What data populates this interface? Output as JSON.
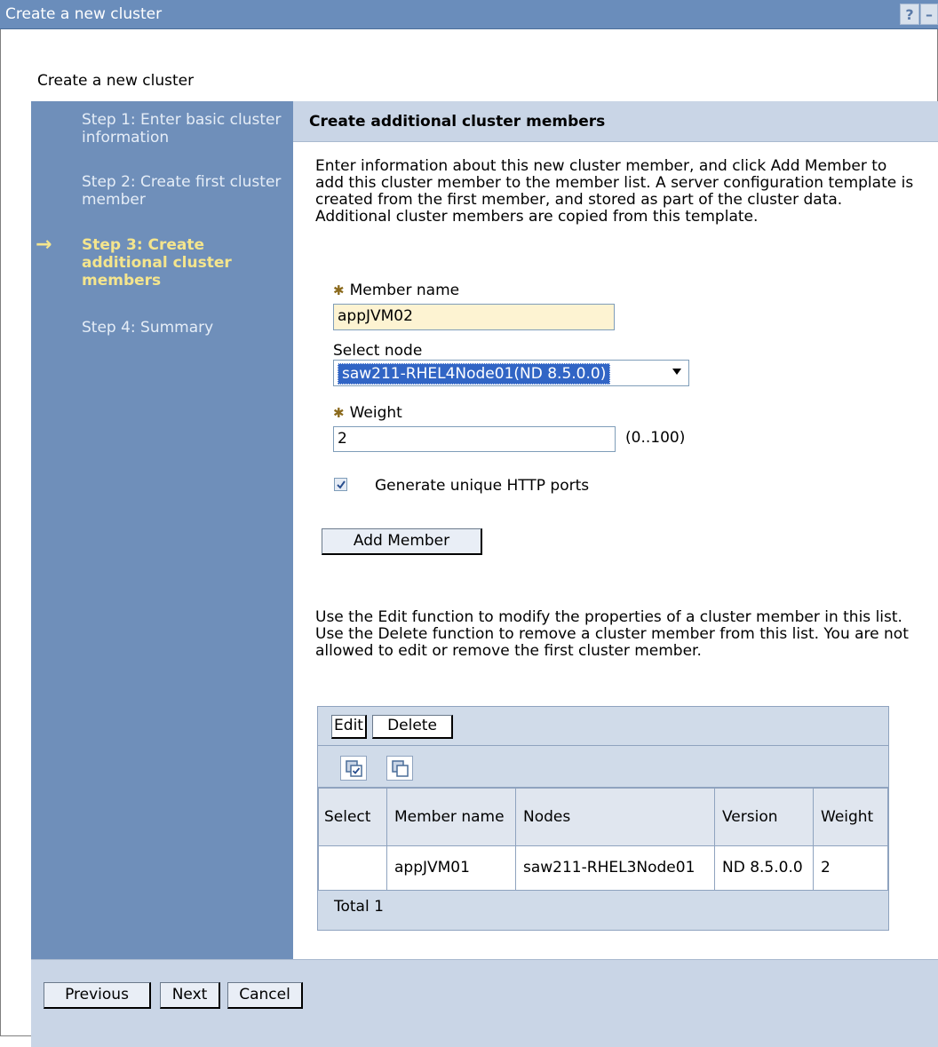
{
  "window": {
    "title": "Create a new cluster",
    "help_label": "?",
    "minimize_label": "–"
  },
  "page_heading": "Create a new cluster",
  "steps": [
    {
      "label": "Step 1: Enter basic cluster information",
      "current": false
    },
    {
      "label": "Step 2: Create first cluster member",
      "current": false
    },
    {
      "label": "Step 3: Create additional cluster members",
      "current": true
    },
    {
      "label": "Step 4: Summary",
      "current": false
    }
  ],
  "step_arrow": "→",
  "section": {
    "title": "Create additional cluster members",
    "intro": "Enter information about this new cluster member, and click Add Member to add this cluster member to the member list. A server configuration template is created from the first member, and stored as part of the cluster data. Additional cluster members are copied from this template."
  },
  "form": {
    "required_marker": "✱",
    "member_name_label": "Member name",
    "member_name_value": "appJVM02",
    "select_node_label": "Select node",
    "select_node_value": "saw211-RHEL4Node01(ND 8.5.0.0)",
    "weight_label": "Weight",
    "weight_value": "2",
    "weight_range": "(0..100)",
    "generate_ports_label": "Generate unique HTTP ports",
    "generate_ports_checked": true,
    "add_member_button": "Add Member"
  },
  "list_help": "Use the Edit function to modify the properties of a cluster member in this list. Use the Delete function to remove a cluster member from this list. You are not allowed to edit or remove the first cluster member.",
  "table": {
    "edit_button": "Edit",
    "delete_button": "Delete",
    "columns": [
      "Select",
      "Member name",
      "Nodes",
      "Version",
      "Weight"
    ],
    "rows": [
      {
        "select": "",
        "member_name": "appJVM01",
        "nodes": "saw211-RHEL3Node01",
        "version": "ND 8.5.0.0",
        "weight": "2"
      }
    ],
    "total": "Total 1"
  },
  "footer": {
    "previous": "Previous",
    "next": "Next",
    "cancel": "Cancel"
  },
  "colors": {
    "sidebar": "#6f8fba",
    "titlebar": "#6a8dbb",
    "header": "#c9d5e6",
    "current_step": "#f4e58d"
  }
}
